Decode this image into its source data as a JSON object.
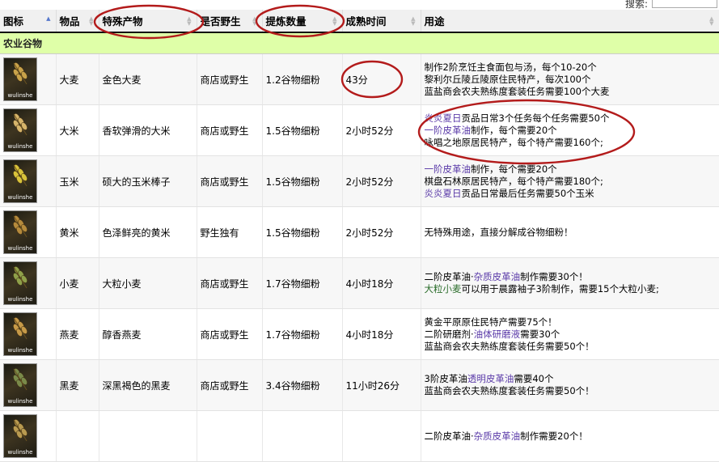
{
  "search": {
    "label": "搜索:",
    "value": ""
  },
  "columns": [
    {
      "label": "图标"
    },
    {
      "label": "物品"
    },
    {
      "label": "特殊产物"
    },
    {
      "label": "是否野生"
    },
    {
      "label": "提炼数量"
    },
    {
      "label": "成熟时间"
    },
    {
      "label": "用途"
    }
  ],
  "section": {
    "title": "农业谷物"
  },
  "watermark": "wulinshe",
  "rows": [
    {
      "item": "大麦",
      "special": "金色大麦",
      "wild": "商店或野生",
      "refine": "1.2谷物细粉",
      "time": "43分",
      "icon": "barley-icon",
      "usage": [
        [
          {
            "t": "制作2阶烹饪主食面包与汤，每个10-20个"
          }
        ],
        [
          {
            "t": "黎利尔丘陵丘陵原住民特产，每次100个"
          }
        ],
        [
          {
            "t": "蓝盐商会农夫熟练度套装任务需要100个大麦"
          }
        ]
      ]
    },
    {
      "item": "大米",
      "special": "香软弹滑的大米",
      "wild": "商店或野生",
      "refine": "1.5谷物细粉",
      "time": "2小时52分",
      "icon": "rice-icon",
      "usage": [
        [
          {
            "t": "炎炎夏日",
            "c": "link"
          },
          {
            "t": "贡品日常3个任务每个任务需要50个"
          }
        ],
        [
          {
            "t": "一阶皮革油",
            "c": "link"
          },
          {
            "t": "制作，每个需要20个"
          }
        ],
        [
          {
            "t": "咏唱之地原居民特产，每个特产需要160个;"
          }
        ]
      ]
    },
    {
      "item": "玉米",
      "special": "硕大的玉米棒子",
      "wild": "商店或野生",
      "refine": "1.5谷物细粉",
      "time": "2小时52分",
      "icon": "corn-icon",
      "usage": [
        [
          {
            "t": "一阶皮革油",
            "c": "link"
          },
          {
            "t": "制作，每个需要20个"
          }
        ],
        [
          {
            "t": "棋盘石林原居民特产，每个特产需要180个;"
          }
        ],
        [
          {
            "t": "炎炎夏日",
            "c": "link"
          },
          {
            "t": "贡品日常最后任务需要50个玉米"
          }
        ]
      ]
    },
    {
      "item": "黄米",
      "special": "色泽鲜亮的黄米",
      "wild": "野生独有",
      "refine": "1.5谷物细粉",
      "time": "2小时52分",
      "icon": "millet-icon",
      "usage": [
        [
          {
            "t": "无特殊用途，直接分解成谷物细粉！"
          }
        ]
      ]
    },
    {
      "item": "小麦",
      "special": "大粒小麦",
      "wild": "商店或野生",
      "refine": "1.7谷物细粉",
      "time": "4小时18分",
      "icon": "wheat-icon",
      "usage": [
        [
          {
            "t": "二阶皮革油·"
          },
          {
            "t": "杂质皮革油",
            "c": "link"
          },
          {
            "t": "制作需要30个！"
          }
        ],
        [
          {
            "t": "大粒小麦",
            "c": "link2"
          },
          {
            "t": "可以用于晨露袖子3阶制作，需要15个大粒小麦;"
          }
        ]
      ]
    },
    {
      "item": "燕麦",
      "special": "醇香燕麦",
      "wild": "商店或野生",
      "refine": "1.7谷物细粉",
      "time": "4小时18分",
      "icon": "oat-icon",
      "usage": [
        [
          {
            "t": "黄金平原原住民特产需要75个！"
          }
        ],
        [
          {
            "t": "二阶研磨剂·"
          },
          {
            "t": "油体研磨液",
            "c": "link"
          },
          {
            "t": "需要30个"
          }
        ],
        [
          {
            "t": "蓝盐商会农夫熟练度套装任务需要50个！"
          }
        ]
      ]
    },
    {
      "item": "黑麦",
      "special": "深黑褐色的黑麦",
      "wild": "商店或野生",
      "refine": "3.4谷物细粉",
      "time": "11小时26分",
      "icon": "rye-icon",
      "usage": [
        [
          {
            "t": "3阶皮革油"
          },
          {
            "t": "透明皮革油",
            "c": "link"
          },
          {
            "t": "需要40个"
          }
        ],
        [
          {
            "t": "蓝盐商会农夫熟练度套装任务需要50个！"
          }
        ]
      ]
    },
    {
      "item": "",
      "special": "",
      "wild": "",
      "refine": "",
      "time": "",
      "icon": "grain-icon",
      "usage": [
        [
          {
            "t": "二阶皮革油·"
          },
          {
            "t": "杂质皮革油",
            "c": "link"
          },
          {
            "t": "制作需要20个！"
          }
        ]
      ]
    }
  ]
}
